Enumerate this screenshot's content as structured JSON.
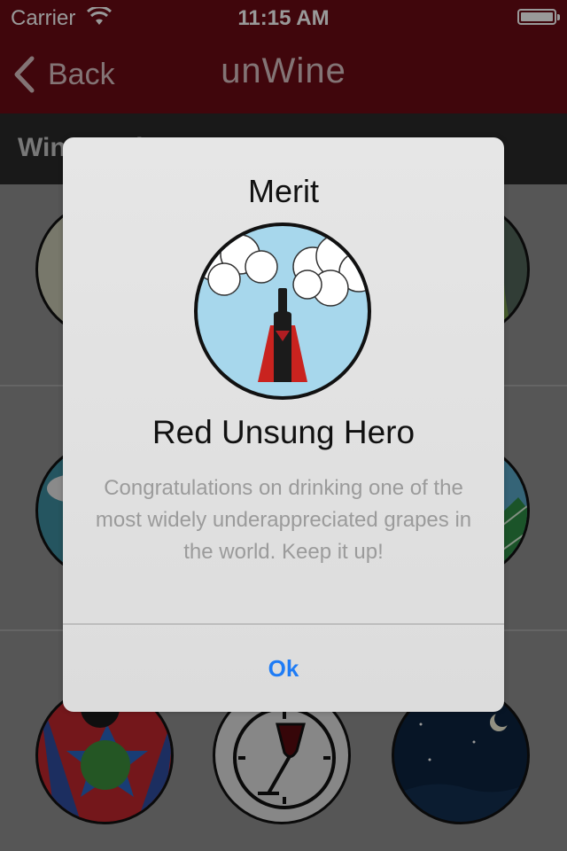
{
  "status_bar": {
    "carrier": "Carrier",
    "time": "11:15 AM"
  },
  "nav": {
    "back_label": "Back",
    "app_title": "unWine"
  },
  "section": {
    "title": "Wine Merits"
  },
  "alert": {
    "title": "Merit",
    "merit_name": "Red Unsung Hero",
    "message": "Congratulations on drinking one of the most widely underappreciated grapes in the world.  Keep it up!",
    "ok_label": "Ok"
  },
  "colors": {
    "nav": "#6c0a14",
    "link": "#1f7cf5",
    "message": "#9b9b9b"
  },
  "icons": [
    "wifi-icon",
    "battery-icon",
    "chevron-left-icon",
    "wine-bottle-icon",
    "cloud-icon",
    "wine-glass-icon",
    "clock-icon",
    "moon-icon"
  ]
}
